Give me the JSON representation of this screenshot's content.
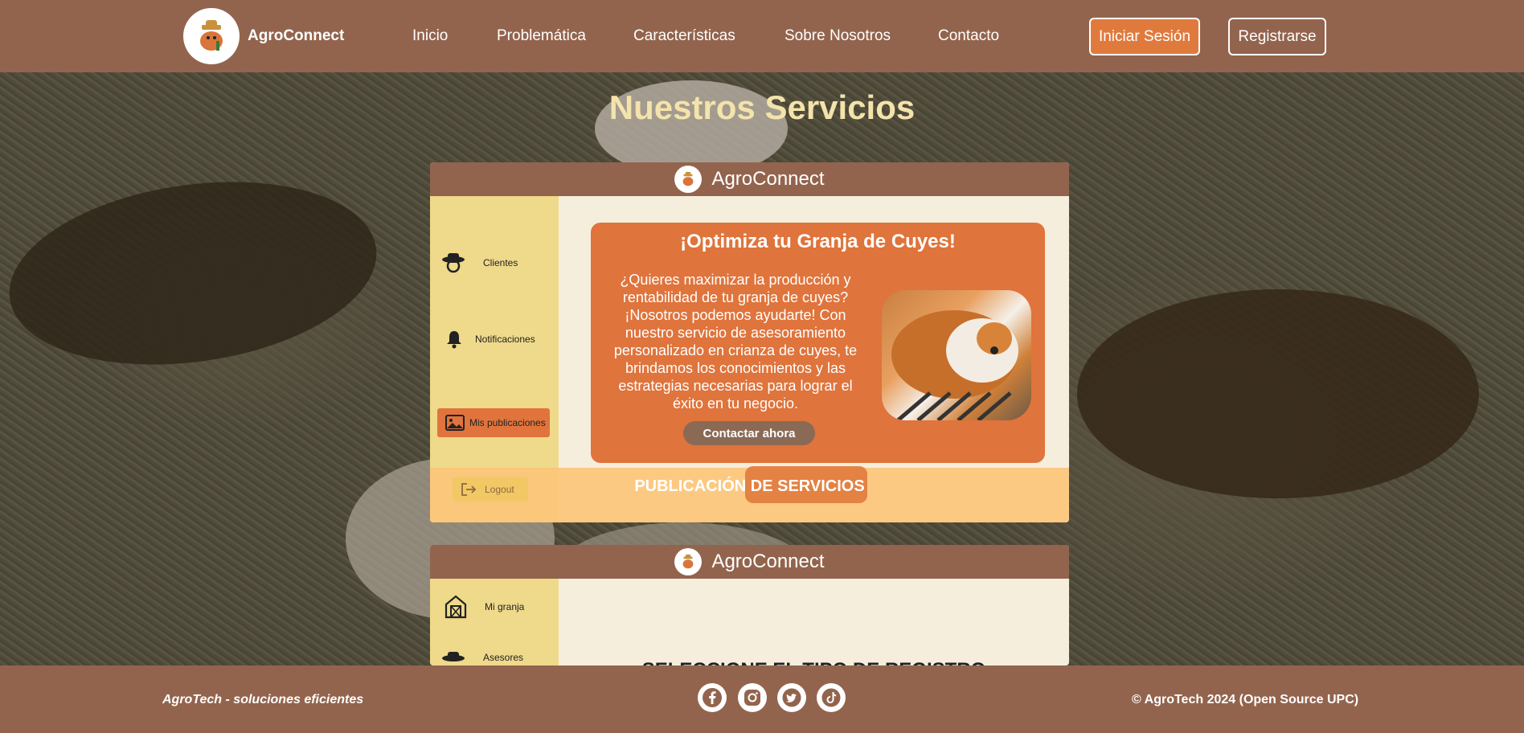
{
  "header": {
    "brand": "AgroConnect",
    "nav": [
      "Inicio",
      "Problemática",
      "Características",
      "Sobre Nosotros",
      "Contacto"
    ],
    "login_label": "Iniciar Sesión",
    "register_label": "Registrarse"
  },
  "section_title": "Nuestros Servicios",
  "card1": {
    "brand": "AgroConnect",
    "sidebar": [
      "Clientes",
      "Notificaciones",
      "Mis publicaciones"
    ],
    "logout_label": "Logout",
    "promo": {
      "title": "¡Optimiza tu Granja de Cuyes!",
      "text": "¿Quieres maximizar la producción y rentabilidad de tu granja de cuyes? ¡Nosotros podemos ayudarte! Con nuestro servicio de asesoramiento personalizado en crianza de cuyes, te brindamos los conocimientos y las estrategias necesarias para lograr el éxito en tu negocio.",
      "button": "Contactar ahora"
    },
    "publication_title": "PUBLICACIÓN DE SERVICIOS"
  },
  "card2": {
    "brand": "AgroConnect",
    "sidebar": [
      "Mi granja",
      "Asesores"
    ],
    "heading": "SELECCIONE EL TIPO DE REGISTRO"
  },
  "footer": {
    "left": "AgroTech - soluciones eficientes",
    "right": "© AgroTech 2024 (Open Source UPC)",
    "social": [
      "facebook-icon",
      "instagram-icon",
      "twitter-icon",
      "tiktok-icon"
    ]
  },
  "colors": {
    "header_bg": "#93644d",
    "accent_orange": "#e07a3c",
    "sidebar_yellow": "#efd98a",
    "title_cream": "#f4e3ab"
  }
}
